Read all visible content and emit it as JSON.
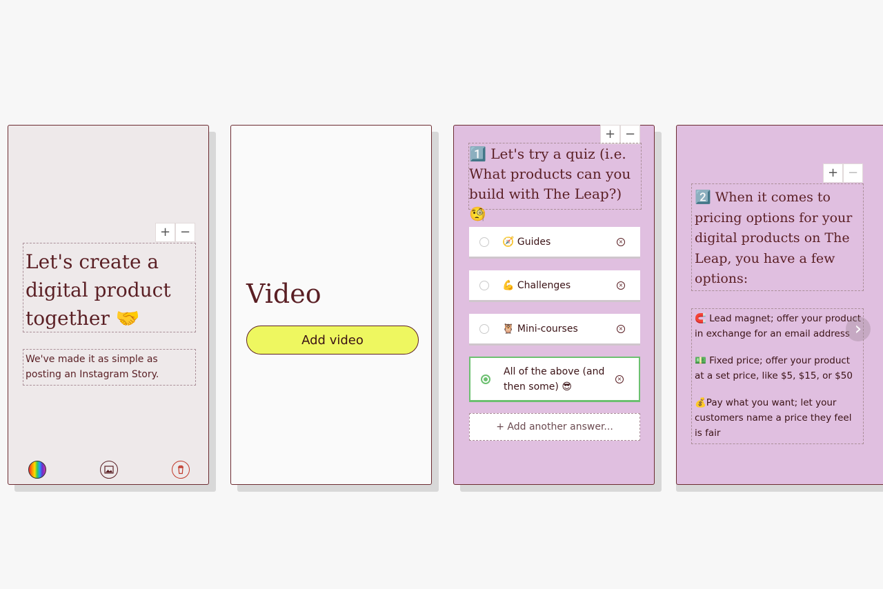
{
  "card1": {
    "heading": "Let's create a digital product together 🤝",
    "subtext": "We've made it as simple as posting an Instagram Story.",
    "stepper": {
      "plus": "+",
      "minus": "−"
    },
    "toolbar": {
      "color_icon": "rainbow-color-icon",
      "image_icon": "image-icon",
      "trash_icon": "trash-icon"
    }
  },
  "card2": {
    "title": "Video",
    "add_button": "Add video"
  },
  "card3": {
    "stepper": {
      "plus": "+",
      "minus": "−"
    },
    "question": "1️⃣ Let's try a quiz (i.e. What products can you build with The Leap?) 🧐",
    "answers": [
      {
        "label": "🧭 Guides",
        "selected": false
      },
      {
        "label": "💪 Challenges",
        "selected": false
      },
      {
        "label": "🦉 Mini-courses",
        "selected": false
      },
      {
        "label": "All of the above (and then some) 😎",
        "selected": true
      }
    ],
    "remove_symbol": "×",
    "add_answer": "+ Add another answer..."
  },
  "card4": {
    "stepper": {
      "plus": "+",
      "minus": "−"
    },
    "question": "2️⃣ When it comes to pricing options for your digital products on The Leap, you have a few options:",
    "options": [
      "🧲 Lead magnet; offer your product in exchange for an email address",
      "💵 Fixed price; offer your product at a set price, like $5, $15, or $50",
      "💰Pay what you want; let your customers name a price they feel is fair"
    ]
  },
  "nav": {
    "next_symbol": "›"
  },
  "colors": {
    "accent_yellow": "#eef760",
    "pink_card": "#e0bfe0",
    "selected_green": "#6cc070",
    "text": "#5a1f24"
  }
}
